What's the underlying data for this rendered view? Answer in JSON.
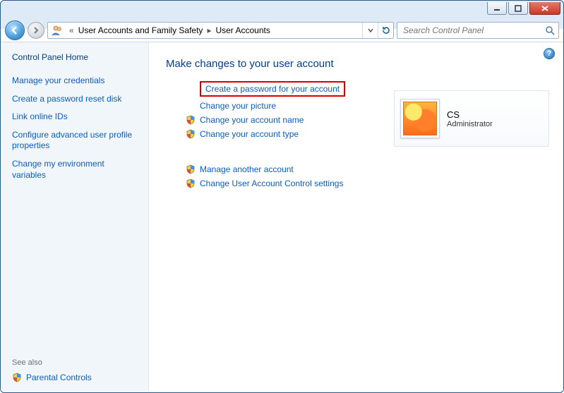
{
  "breadcrumb": {
    "parent": "User Accounts and Family Safety",
    "current": "User Accounts"
  },
  "search": {
    "placeholder": "Search Control Panel"
  },
  "sidebar": {
    "home": "Control Panel Home",
    "links": [
      "Manage your credentials",
      "Create a password reset disk",
      "Link online IDs",
      "Configure advanced user profile properties",
      "Change my environment variables"
    ],
    "see_also_label": "See also",
    "see_also_item": "Parental Controls"
  },
  "main": {
    "heading": "Make changes to your user account",
    "actions_primary": [
      {
        "label": "Create a password for your account",
        "shield": false,
        "highlight": true
      },
      {
        "label": "Change your picture",
        "shield": false,
        "highlight": false
      },
      {
        "label": "Change your account name",
        "shield": true,
        "highlight": false
      },
      {
        "label": "Change your account type",
        "shield": true,
        "highlight": false
      }
    ],
    "actions_secondary": [
      {
        "label": "Manage another account",
        "shield": true
      },
      {
        "label": "Change User Account Control settings",
        "shield": true
      }
    ]
  },
  "account": {
    "name": "CS",
    "role": "Administrator"
  },
  "help": "?"
}
